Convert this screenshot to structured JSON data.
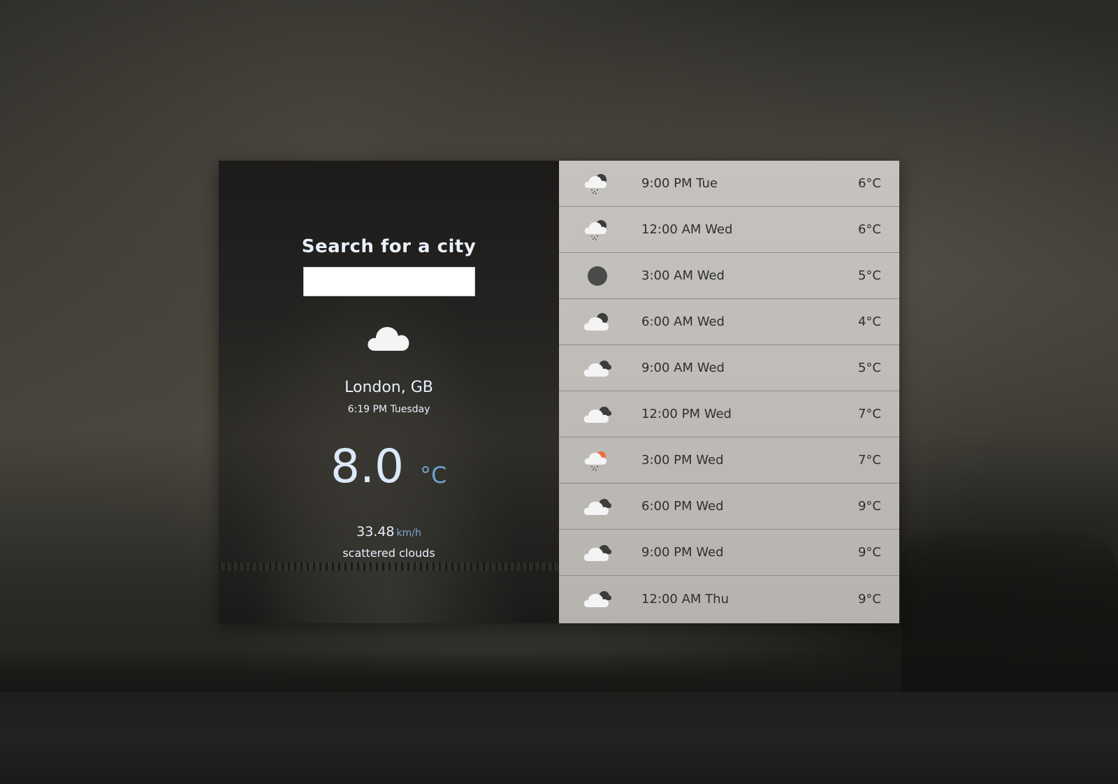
{
  "search": {
    "title": "Search for a city",
    "value": "",
    "placeholder": ""
  },
  "current": {
    "icon": "cloud-icon",
    "city": "London, GB",
    "datetime": "6:19 PM Tuesday",
    "temperature": "8.0",
    "temperature_unit": "°C",
    "wind_speed": "33.48",
    "wind_unit": "km/h",
    "description": "scattered clouds"
  },
  "colors": {
    "accent": "#6fa1cf",
    "text_light": "#e8f0fb",
    "panel_right": "#c2bfba",
    "sun": "#f06a3a"
  },
  "forecast": [
    {
      "icon": "night-rain-cloud-icon",
      "time": "9:00 PM Tue",
      "temp": "6°C"
    },
    {
      "icon": "night-rain-cloud-icon",
      "time": "12:00 AM Wed",
      "temp": "6°C"
    },
    {
      "icon": "moon-icon",
      "time": "3:00 AM Wed",
      "temp": "5°C"
    },
    {
      "icon": "night-cloud-icon",
      "time": "6:00 AM Wed",
      "temp": "4°C"
    },
    {
      "icon": "broken-clouds-icon",
      "time": "9:00 AM Wed",
      "temp": "5°C"
    },
    {
      "icon": "broken-clouds-icon",
      "time": "12:00 PM Wed",
      "temp": "7°C"
    },
    {
      "icon": "sun-rain-cloud-icon",
      "time": "3:00 PM Wed",
      "temp": "7°C"
    },
    {
      "icon": "broken-clouds-icon",
      "time": "6:00 PM Wed",
      "temp": "9°C"
    },
    {
      "icon": "broken-clouds-icon",
      "time": "9:00 PM Wed",
      "temp": "9°C"
    },
    {
      "icon": "broken-clouds-icon",
      "time": "12:00 AM Thu",
      "temp": "9°C"
    }
  ]
}
